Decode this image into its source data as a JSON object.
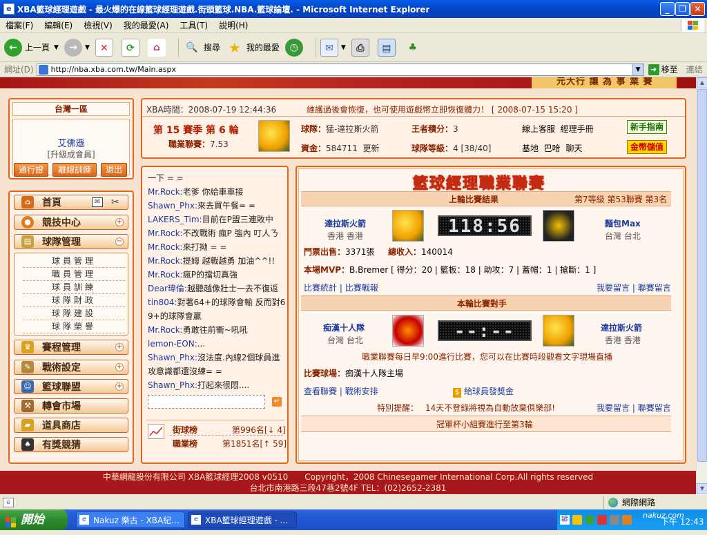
{
  "window": {
    "title": "XBA籃球經理遊戲 - 最火爆的在線籃球經理遊戲.街頭籃球.NBA.籃球論壇. - Microsoft Internet Explorer",
    "min": "_",
    "max": "❐",
    "close": "✕"
  },
  "menu": [
    "檔案(F)",
    "編輯(E)",
    "檢視(V)",
    "我的最愛(A)",
    "工具(T)",
    "說明(H)"
  ],
  "toolbar": {
    "back": "上一頁",
    "search": "搜尋",
    "favorites": "我的最愛"
  },
  "address": {
    "label": "網址(D)",
    "url": "http://nba.xba.com.tw/Main.aspx",
    "go": "移至",
    "links": "連結"
  },
  "banner": {
    "slogan": "元大行 讓 為 事 業 賽"
  },
  "left": {
    "region": "台灣一區",
    "username": "艾佛遜",
    "member": "[升級成會員]",
    "buttons": [
      "通行證",
      "離線訓練",
      "退出"
    ],
    "nav": [
      {
        "label": "首頁"
      },
      {
        "label": "競技中心"
      },
      {
        "label": "球隊管理"
      },
      {
        "label": "賽程管理"
      },
      {
        "label": "戰術設定"
      },
      {
        "label": "籃球聯盟"
      },
      {
        "label": "轉會市場"
      },
      {
        "label": "道具商店"
      },
      {
        "label": "有獎競猜"
      }
    ],
    "team_sub": [
      "球員管理",
      "職員管理",
      "球員訓練",
      "球隊財政",
      "球隊建設",
      "球隊榮譽"
    ]
  },
  "info": {
    "time_label": "XBA時間：",
    "time": "2008-07-19 12:44:36",
    "notice": "維護過後會恢復，也可使用遊戲幣立即恢復體力！ [ 2008-07-15 15:20 ]",
    "season": "第 15 賽季 第 6 輪",
    "league_label": "職業聯賽：",
    "league_val": "7.53",
    "team_label": "球隊：",
    "team": "猛-達拉斯火箭",
    "king_label": "王者積分：",
    "king": "3",
    "service": "線上客服",
    "manual": "經理手冊",
    "guide_btn": "新手指南",
    "funds_label": "資金：",
    "funds": "584711",
    "update": "更新",
    "level_label": "球隊等級：",
    "level": "4 [38/40]",
    "base": "基地",
    "bar": "巴哈",
    "chat": "聊天",
    "coin_btn": "金幣儲值"
  },
  "chat": {
    "lines": [
      {
        "name": "",
        "text": "一下 = ="
      },
      {
        "name": "Mr.Rock:",
        "text": "老爹 你給車車接"
      },
      {
        "name": "Shawn_Phx:",
        "text": "來去買午餐= ="
      },
      {
        "name": "LAKERS_Tim:",
        "text": "目前在P盟三連敗中"
      },
      {
        "name": "Mr.Rock:",
        "text": "不改戰術 瘋P 強內 叮人ㄋ"
      },
      {
        "name": "Mr.Rock:",
        "text": "來打拗 = ="
      },
      {
        "name": "Mr.Rock:",
        "text": "提姆 越戰越勇 加油^^!!"
      },
      {
        "name": "Mr.Rock:",
        "text": "瘋P的擋切真強"
      },
      {
        "name": "Dear瑋倫:",
        "text": "越聽越像壯士一去不復返"
      },
      {
        "name": "tin804:",
        "text": "對著64+的球隊會輸 反而對6"
      },
      {
        "name": "",
        "text": "9+的球隊會贏"
      },
      {
        "name": "Mr.Rock:",
        "text": "勇敢往前衝~吼吼"
      },
      {
        "name": "lemon-EON:",
        "text": "..."
      },
      {
        "name": "Shawn_Phx:",
        "text": "沒法度.內線2個球員進"
      },
      {
        "name": "",
        "text": "攻意識都還沒練= ="
      },
      {
        "name": "Shawn_Phx:",
        "text": "打起來很悶...."
      }
    ],
    "street_label": "街球榜",
    "street_rank": "第996名[↓ 4]",
    "pro_label": "職業榜",
    "pro_rank": "第1851名[↑ 59]"
  },
  "league": {
    "title": "籃球經理職業聯賽",
    "last_result": "上輪比賽結果",
    "last_info": "第7等級 第53聯賽 第3名",
    "home": {
      "name": "達拉斯火箭",
      "loc": "香港 香港"
    },
    "away": {
      "name": "麵包Max",
      "loc": "台灣 台北"
    },
    "score": "118:56",
    "ticket_label": "門票出售：",
    "ticket": "3371張",
    "income_label": "總收入：",
    "income": "140014",
    "mvp_label": "本場MVP：",
    "mvp": "B.Bremer [ 得分：20 | 籃板：18 | 助攻：7 | 蓋帽：1 | 搶斷：1 ]",
    "stats": "比賽統計",
    "report": "比賽戰報",
    "msg1": "我要留言",
    "msg2": "聯賽留言",
    "next_title": "本輪比賽對手",
    "opp": {
      "name": "痴漢十人隊",
      "loc": "台灣 台北"
    },
    "own": {
      "name": "達拉斯火箭",
      "loc": "香港 香港"
    },
    "next_score": "--:--",
    "schedule": "職業聯賽每日早9:00進行比賽，您可以在比賽時段觀看文字現場直播",
    "venue_label": "比賽球場：",
    "venue": "痴漢十人隊主場",
    "view": "查看聯賽",
    "tactics": "戰術安排",
    "bonus": "給球員發獎金",
    "tip_label": "特別提醒：",
    "tip": "14天不登錄將視為自動放棄俱樂部!",
    "cup": "冠軍杯小組賽進行至第3輪"
  },
  "footer": {
    "line1": "中華網龍股份有限公司 XBA籃球經理2008 v0510　　Copyright，2008 Chinesegamer International Corp.All rights reserved",
    "line2": "台北市南港路三段47巷2號4F TEL：(02)2652-2381"
  },
  "status": {
    "zone": "網際網路"
  },
  "taskbar": {
    "start": "開始",
    "tasks": [
      "Nakuz 樂古 - XBA紀...",
      "XBA籃球經理遊戲 - ..."
    ],
    "clock": "下午 12:43",
    "watermark": "nakuz.com"
  }
}
